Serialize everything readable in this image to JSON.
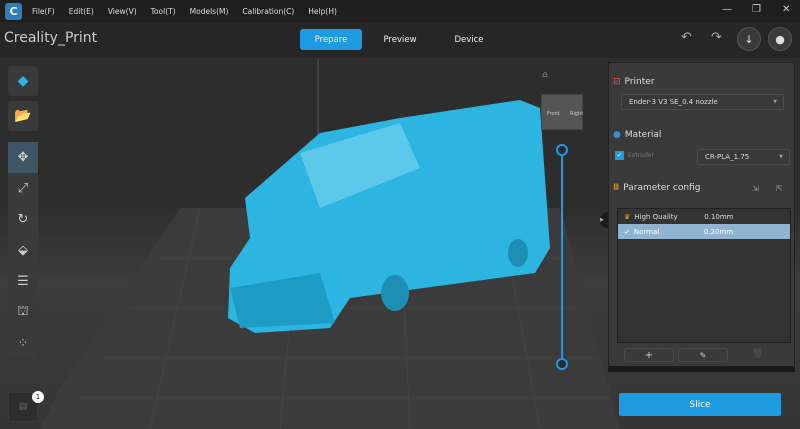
{
  "menubar": {
    "items": [
      "File(F)",
      "Edit(E)",
      "View(V)",
      "Tool(T)",
      "Models(M)",
      "Calibration(C)",
      "Help(H)"
    ]
  },
  "header": {
    "title": "Creality_Print",
    "tabs": [
      "Prepare",
      "Preview",
      "Device"
    ]
  },
  "viewcube": {
    "front": "Front",
    "right": "Right"
  },
  "panel": {
    "printer": {
      "title": "Printer",
      "value": "Ender-3 V3 SE_0.4 nozzle"
    },
    "material": {
      "title": "Material",
      "extruder": "Extruder",
      "value": "CR-PLA_1.75"
    },
    "param": {
      "title": "Parameter config",
      "rows": [
        {
          "name": "High Quality",
          "value": "0.10mm"
        },
        {
          "name": "Normal",
          "value": "0.20mm"
        }
      ]
    }
  },
  "slice_label": "Slice",
  "badge": "1",
  "colors": {
    "accent": "#1e9be0",
    "model": "#2bb5e0"
  }
}
